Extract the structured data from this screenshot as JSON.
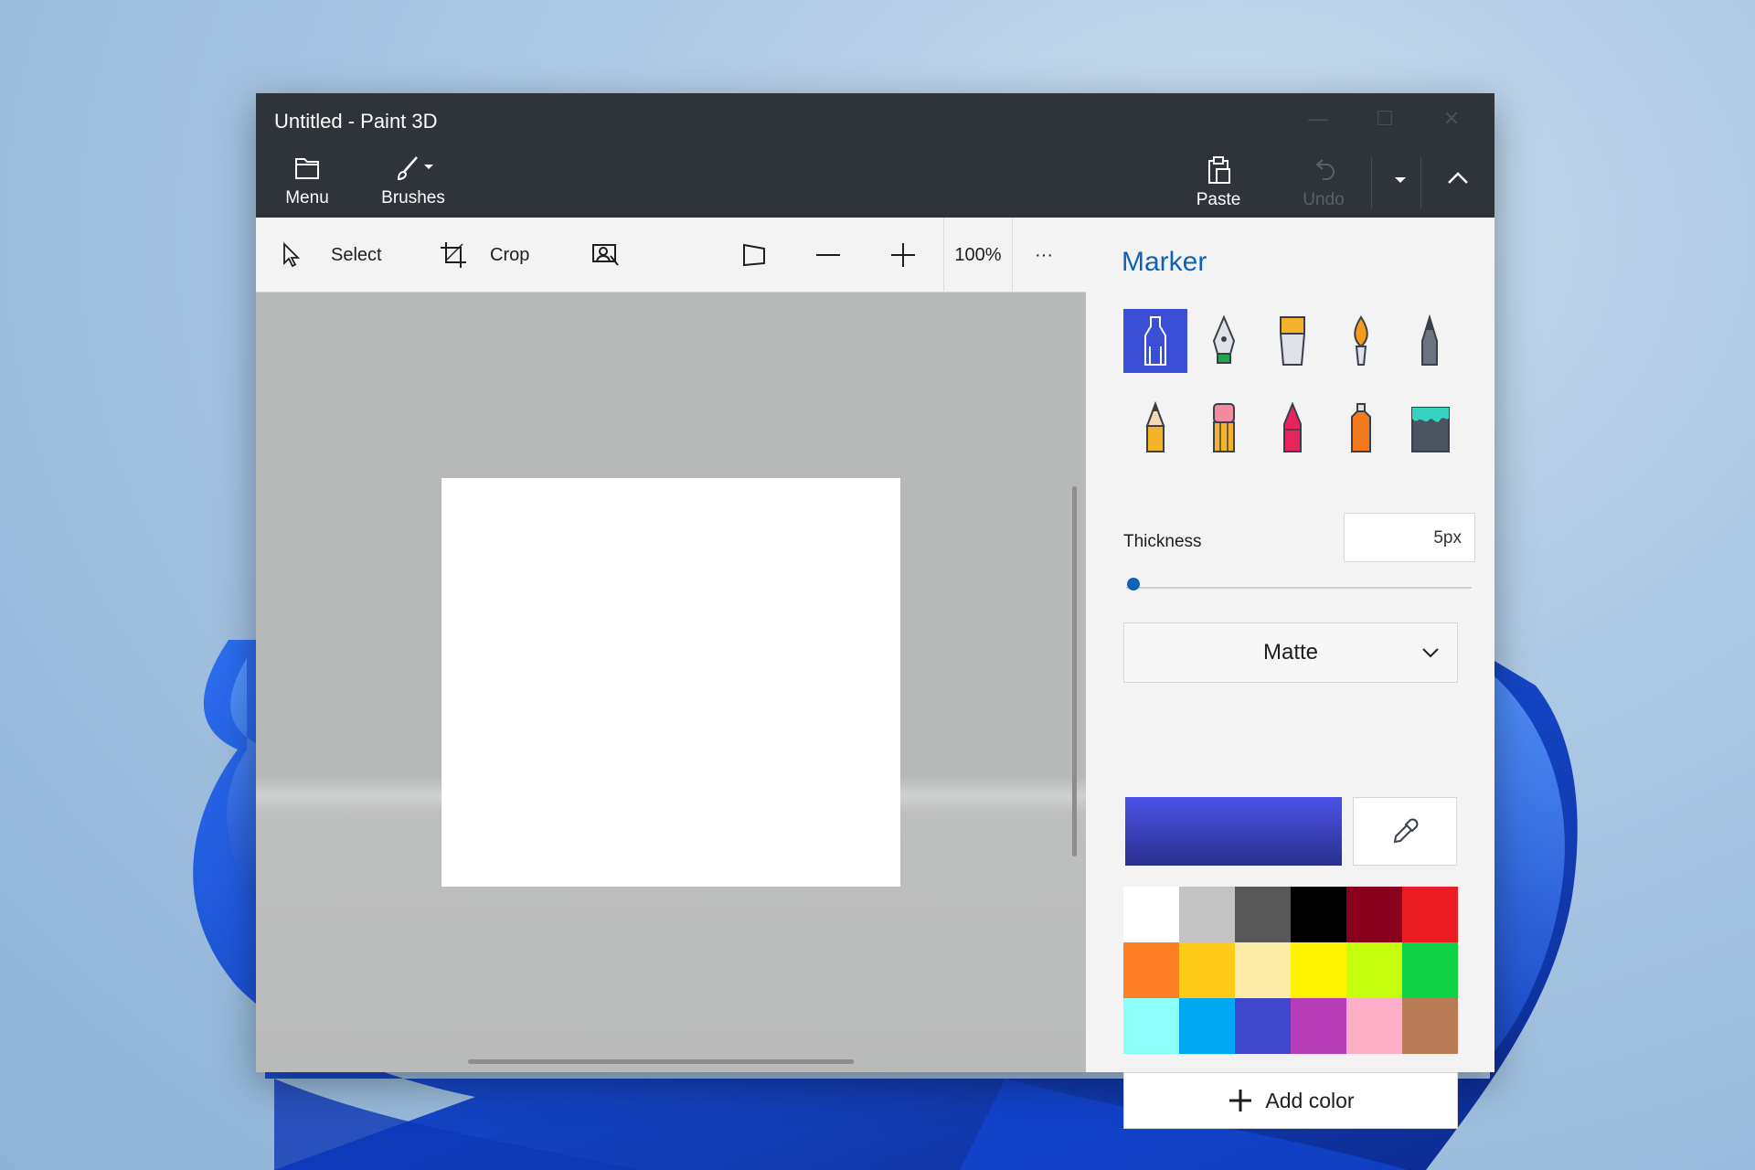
{
  "window": {
    "title": "Untitled - Paint 3D"
  },
  "ribbon": {
    "menu_label": "Menu",
    "brushes_label": "Brushes",
    "paste_label": "Paste",
    "undo_label": "Undo"
  },
  "toolbar": {
    "select_label": "Select",
    "crop_label": "Crop",
    "zoom_level": "100%",
    "more_label": "···"
  },
  "panel": {
    "title": "Marker",
    "brushes": [
      {
        "icon": "marker-icon",
        "selected": true
      },
      {
        "icon": "calligraphy-pen-icon",
        "selected": false
      },
      {
        "icon": "oil-brush-icon",
        "selected": false
      },
      {
        "icon": "watercolor-icon",
        "selected": false
      },
      {
        "icon": "pixel-pen-icon",
        "selected": false
      },
      {
        "icon": "pencil-icon",
        "selected": false
      },
      {
        "icon": "eraser-icon",
        "selected": false
      },
      {
        "icon": "crayon-icon",
        "selected": false
      },
      {
        "icon": "spray-can-icon",
        "selected": false
      },
      {
        "icon": "fill-bucket-icon",
        "selected": false
      }
    ],
    "thickness_label": "Thickness",
    "thickness_value": "5px",
    "thickness_level_fraction": 0.02,
    "finish_value": "Matte",
    "current_color_start": "#4b53e6",
    "current_color_end": "#2a2f8e",
    "palette": [
      "#ffffff",
      "#c3c3c3",
      "#585858",
      "#000000",
      "#88001b",
      "#ec1c24",
      "#ff7f27",
      "#ffca18",
      "#fdeca6",
      "#fff200",
      "#c4ff0e",
      "#0ed145",
      "#8cfffb",
      "#00a8f3",
      "#3f48cc",
      "#b83dba",
      "#ffaec8",
      "#b97a56"
    ],
    "add_color_label": "Add color"
  },
  "colors": {
    "accent": "#0f63b6",
    "titlebar": "#2f333a"
  }
}
